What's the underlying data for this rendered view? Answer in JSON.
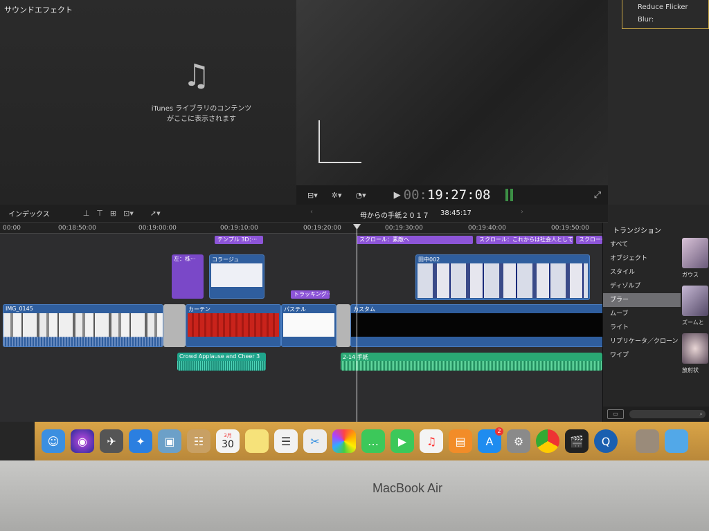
{
  "sound_effects": {
    "title": "サウンドエフェクト",
    "note_icon": "music-note-icon",
    "message_line1": "iTunes ライブラリのコンテンツ",
    "message_line2": "がここに表示されます"
  },
  "inspector": {
    "item1": "Reduce Flicker",
    "item2": "Blur:"
  },
  "viewer": {
    "timecode_dim": "00:",
    "timecode": "19:27:08"
  },
  "timeline": {
    "index_label": "インデックス",
    "project_name": "母からの手紙２０１７",
    "project_duration": "38:45:17",
    "ruler": [
      "00:00",
      "00:18:50:00",
      "00:19:00:00",
      "00:19:10:00",
      "00:19:20:00",
      "00:19:30:00",
      "00:19:40:00",
      "00:19:50:00"
    ],
    "titles": {
      "t1": "テンプル 3D：···",
      "t2": "スクロール：素敵へ",
      "t3": "スクロール：これからは社会人として···",
      "t4": "スクロー···",
      "t5": "トラッキング···"
    },
    "clips": {
      "c1": "左：株···",
      "c2": "コラージュ",
      "c3": "田中002",
      "c4": "IMG_0145",
      "c5": "カーテン",
      "c6": "パステル",
      "c7": "カスタム",
      "a1": "Crowd Applause and Cheer 3",
      "a2": "2-14 手紙"
    }
  },
  "transitions": {
    "title": "トランジション",
    "categories": [
      "すべて",
      "オブジェクト",
      "スタイル",
      "ディゾルブ",
      "ブラー",
      "ムーブ",
      "ライト",
      "リプリケータ／クローン",
      "ワイプ"
    ],
    "selected": "ブラー",
    "thumb_labels": [
      "ガウス",
      "ズームと",
      "放射状"
    ]
  },
  "dock": {
    "calendar_month": "3月",
    "calendar_day": "30",
    "appstore_badge": "2"
  },
  "device": {
    "brand": "MacBook Air"
  },
  "colors": {
    "title_purple": "#8d55d8",
    "clip_blue": "#2f5e9e",
    "audio_teal": "#1fa58c",
    "audio_green": "#2aa874",
    "selection": "#6e6e72"
  }
}
